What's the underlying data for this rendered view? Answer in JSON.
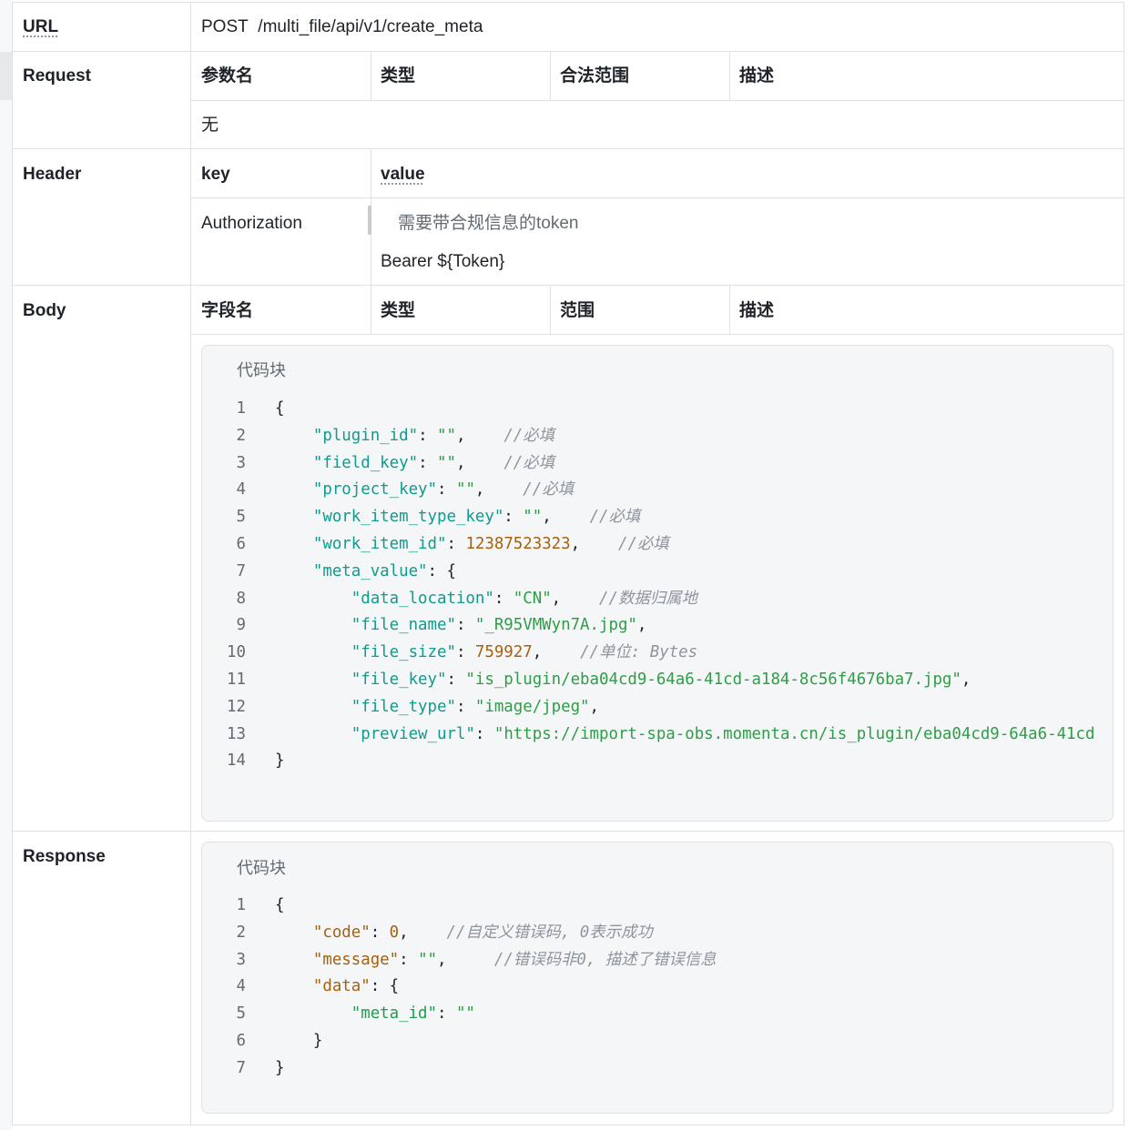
{
  "url": {
    "label": "URL",
    "method": "POST",
    "path": "/multi_file/api/v1/create_meta"
  },
  "request": {
    "label": "Request",
    "columns": [
      "参数名",
      "类型",
      "合法范围",
      "描述"
    ],
    "empty": "无"
  },
  "header": {
    "label": "Header",
    "columns": [
      "key",
      "value"
    ],
    "row": {
      "key": "Authorization",
      "note": "需要带合规信息的token",
      "value": "Bearer ${Token}"
    }
  },
  "body": {
    "label": "Body",
    "columns": [
      "字段名",
      "类型",
      "范围",
      "描述"
    ],
    "code": {
      "label": "代码块",
      "line_numbers": [
        "1",
        "2",
        "3",
        "4",
        "5",
        "6",
        "7",
        "8",
        "9",
        "10",
        "11",
        "12",
        "13",
        "14"
      ],
      "lines": [
        {
          "tokens": [
            {
              "t": "{",
              "c": "p"
            }
          ]
        },
        {
          "tokens": [
            {
              "t": "    ",
              "c": "p"
            },
            {
              "t": "\"plugin_id\"",
              "c": "k"
            },
            {
              "t": ": ",
              "c": "p"
            },
            {
              "t": "\"\"",
              "c": "s"
            },
            {
              "t": ",    ",
              "c": "p"
            },
            {
              "t": "//必填",
              "c": "c"
            }
          ]
        },
        {
          "tokens": [
            {
              "t": "    ",
              "c": "p"
            },
            {
              "t": "\"field_key\"",
              "c": "k"
            },
            {
              "t": ": ",
              "c": "p"
            },
            {
              "t": "\"\"",
              "c": "s"
            },
            {
              "t": ",    ",
              "c": "p"
            },
            {
              "t": "//必填",
              "c": "c"
            }
          ]
        },
        {
          "tokens": [
            {
              "t": "    ",
              "c": "p"
            },
            {
              "t": "\"project_key\"",
              "c": "k"
            },
            {
              "t": ": ",
              "c": "p"
            },
            {
              "t": "\"\"",
              "c": "s"
            },
            {
              "t": ",    ",
              "c": "p"
            },
            {
              "t": "//必填",
              "c": "c"
            }
          ]
        },
        {
          "tokens": [
            {
              "t": "    ",
              "c": "p"
            },
            {
              "t": "\"work_item_type_key\"",
              "c": "k"
            },
            {
              "t": ": ",
              "c": "p"
            },
            {
              "t": "\"\"",
              "c": "s"
            },
            {
              "t": ",    ",
              "c": "p"
            },
            {
              "t": "//必填",
              "c": "c"
            }
          ]
        },
        {
          "tokens": [
            {
              "t": "    ",
              "c": "p"
            },
            {
              "t": "\"work_item_id\"",
              "c": "k"
            },
            {
              "t": ": ",
              "c": "p"
            },
            {
              "t": "12387523323",
              "c": "n"
            },
            {
              "t": ",    ",
              "c": "p"
            },
            {
              "t": "//必填",
              "c": "c"
            }
          ]
        },
        {
          "tokens": [
            {
              "t": "    ",
              "c": "p"
            },
            {
              "t": "\"meta_value\"",
              "c": "k"
            },
            {
              "t": ": {",
              "c": "p"
            }
          ]
        },
        {
          "tokens": [
            {
              "t": "        ",
              "c": "p"
            },
            {
              "t": "\"data_location\"",
              "c": "k"
            },
            {
              "t": ": ",
              "c": "p"
            },
            {
              "t": "\"CN\"",
              "c": "s"
            },
            {
              "t": ",    ",
              "c": "p"
            },
            {
              "t": "//数据归属地",
              "c": "c"
            }
          ]
        },
        {
          "tokens": [
            {
              "t": "        ",
              "c": "p"
            },
            {
              "t": "\"file_name\"",
              "c": "k"
            },
            {
              "t": ": ",
              "c": "p"
            },
            {
              "t": "\"_R95VMWyn7A.jpg\"",
              "c": "s"
            },
            {
              "t": ",",
              "c": "p"
            }
          ]
        },
        {
          "tokens": [
            {
              "t": "        ",
              "c": "p"
            },
            {
              "t": "\"file_size\"",
              "c": "k"
            },
            {
              "t": ": ",
              "c": "p"
            },
            {
              "t": "759927",
              "c": "n"
            },
            {
              "t": ",    ",
              "c": "p"
            },
            {
              "t": "//单位: Bytes",
              "c": "c"
            }
          ]
        },
        {
          "tokens": [
            {
              "t": "        ",
              "c": "p"
            },
            {
              "t": "\"file_key\"",
              "c": "k"
            },
            {
              "t": ": ",
              "c": "p"
            },
            {
              "t": "\"is_plugin/eba04cd9-64a6-41cd-a184-8c56f4676ba7.jpg\"",
              "c": "s"
            },
            {
              "t": ",",
              "c": "p"
            }
          ]
        },
        {
          "tokens": [
            {
              "t": "        ",
              "c": "p"
            },
            {
              "t": "\"file_type\"",
              "c": "k"
            },
            {
              "t": ": ",
              "c": "p"
            },
            {
              "t": "\"image/jpeg\"",
              "c": "s"
            },
            {
              "t": ",",
              "c": "p"
            }
          ]
        },
        {
          "tokens": [
            {
              "t": "        ",
              "c": "p"
            },
            {
              "t": "\"preview_url\"",
              "c": "k"
            },
            {
              "t": ": ",
              "c": "p"
            },
            {
              "t": "\"https://import-spa-obs.momenta.cn/is_plugin/eba04cd9-64a6-41cd",
              "c": "s"
            }
          ]
        },
        {
          "tokens": [
            {
              "t": "}",
              "c": "p"
            }
          ]
        }
      ]
    }
  },
  "response": {
    "label": "Response",
    "code": {
      "label": "代码块",
      "line_numbers": [
        "1",
        "2",
        "3",
        "4",
        "5",
        "6",
        "7"
      ],
      "lines": [
        {
          "tokens": [
            {
              "t": "{",
              "c": "p"
            }
          ]
        },
        {
          "tokens": [
            {
              "t": "    ",
              "c": "p"
            },
            {
              "t": "\"code\"",
              "c": "n"
            },
            {
              "t": ": ",
              "c": "p"
            },
            {
              "t": "0",
              "c": "n"
            },
            {
              "t": ",    ",
              "c": "p"
            },
            {
              "t": "//自定义错误码, 0表示成功",
              "c": "c"
            }
          ]
        },
        {
          "tokens": [
            {
              "t": "    ",
              "c": "p"
            },
            {
              "t": "\"message\"",
              "c": "n"
            },
            {
              "t": ": ",
              "c": "p"
            },
            {
              "t": "\"\"",
              "c": "s"
            },
            {
              "t": ",     ",
              "c": "p"
            },
            {
              "t": "//错误码非0, 描述了错误信息",
              "c": "c"
            }
          ]
        },
        {
          "tokens": [
            {
              "t": "    ",
              "c": "p"
            },
            {
              "t": "\"data\"",
              "c": "n"
            },
            {
              "t": ": {",
              "c": "p"
            }
          ]
        },
        {
          "tokens": [
            {
              "t": "        ",
              "c": "p"
            },
            {
              "t": "\"meta_id\"",
              "c": "k2"
            },
            {
              "t": ": ",
              "c": "p"
            },
            {
              "t": "\"\"",
              "c": "s"
            }
          ]
        },
        {
          "tokens": [
            {
              "t": "    }",
              "c": "p"
            }
          ]
        },
        {
          "tokens": [
            {
              "t": "}",
              "c": "p"
            }
          ]
        }
      ]
    }
  }
}
